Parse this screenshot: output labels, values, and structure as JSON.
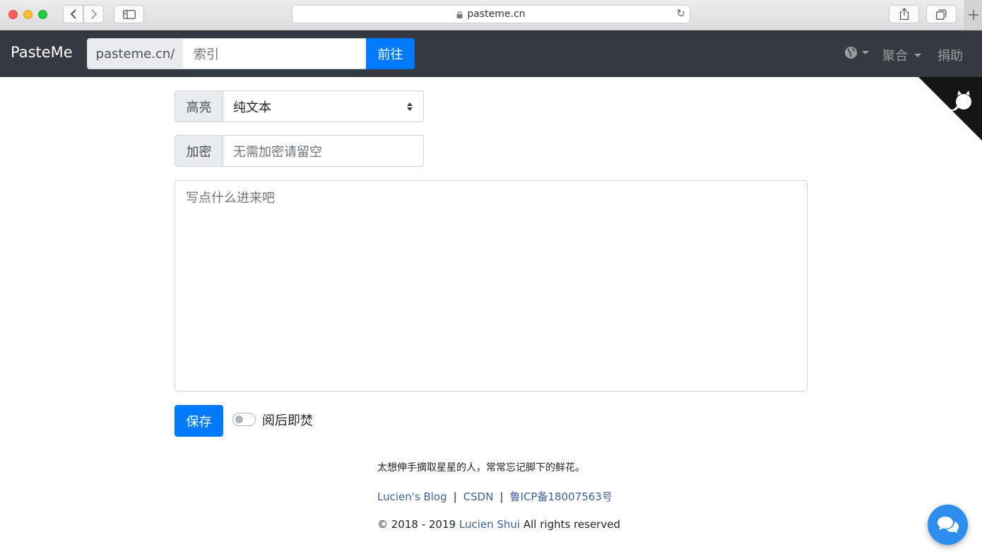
{
  "browser": {
    "url": "pasteme.cn",
    "new_tab_label": "+"
  },
  "navbar": {
    "brand": "PasteMe",
    "prefix": "pasteme.cn/",
    "index_placeholder": "索引",
    "go_button": "前往",
    "aggregate_menu": "聚合",
    "donate_link": "捐助"
  },
  "form": {
    "highlight_label": "高亮",
    "highlight_value": "纯文本",
    "password_label": "加密",
    "password_placeholder": "无需加密请留空",
    "content_placeholder": "写点什么进来吧",
    "save_button": "保存",
    "burn_after_read_label": "阅后即焚",
    "burn_after_read_enabled": false
  },
  "footer": {
    "quote": "太想伸手摘取星星的人，常常忘记脚下的鲜花。",
    "links": [
      "Lucien's Blog",
      "CSDN",
      "鲁ICP备18007563号"
    ],
    "separator": "|",
    "copyright_prefix": "© 2018 - 2019",
    "copyright_author": "Lucien Shui",
    "copyright_suffix": "All rights reserved"
  },
  "colors": {
    "navbar_bg": "#343a40",
    "primary": "#007bff",
    "link": "#3f5fa3",
    "chat_fab": "#2e8eee"
  },
  "icons": {
    "theme": "globe-icon",
    "github": "github-octocat-icon",
    "chat": "chat-bubbles-icon"
  }
}
